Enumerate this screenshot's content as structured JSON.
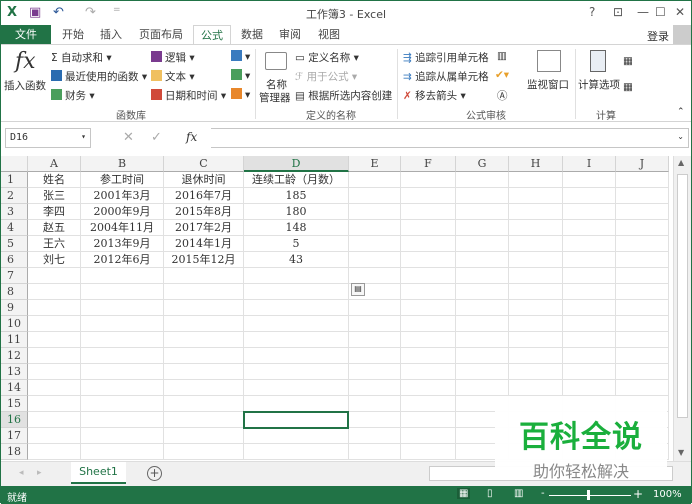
{
  "title": "工作簿3 - Excel",
  "quick_access": {
    "excel": "X",
    "save": "💾",
    "undo": "↶",
    "redo": "↷",
    "customize": "="
  },
  "window_controls": {
    "help": "?",
    "ribbon_options": "⊡",
    "minimize": "—",
    "maximize": "☐",
    "close": "✕"
  },
  "login": "登录",
  "tabs": [
    "文件",
    "开始",
    "插入",
    "页面布局",
    "公式",
    "数据",
    "审阅",
    "视图"
  ],
  "active_tab": "公式",
  "ribbon": {
    "insert_function": "插入函数",
    "autosum": "自动求和",
    "recent": "最近使用的函数",
    "financial": "财务",
    "logical": "逻辑",
    "text": "文本",
    "datetime": "日期和时间",
    "group_library": "函数库",
    "name_manager_1": "名称",
    "name_manager_2": "管理器",
    "define_name": "定义名称",
    "use_in_formula": "用于公式",
    "create_from_selection": "根据所选内容创建",
    "group_names": "定义的名称",
    "trace_precedents": "追踪引用单元格",
    "trace_dependents": "追踪从属单元格",
    "remove_arrows": "移去箭头",
    "watch_window": "监视窗口",
    "group_audit": "公式审核",
    "calc_options": "计算选项",
    "group_calc": "计算"
  },
  "formula_bar": {
    "name_box": "D16",
    "cancel": "✕",
    "enter": "✓",
    "fx": "fx",
    "value": ""
  },
  "columns": [
    "A",
    "B",
    "C",
    "D",
    "E",
    "F",
    "G",
    "H",
    "I",
    "J"
  ],
  "rows": [
    [
      "姓名",
      "参工时间",
      "退休时间",
      "连续工龄（月数）"
    ],
    [
      "张三",
      "2001年3月",
      "2016年7月",
      "185"
    ],
    [
      "李四",
      "2000年9月",
      "2015年8月",
      "180"
    ],
    [
      "赵五",
      "2004年11月",
      "2017年2月",
      "148"
    ],
    [
      "王六",
      "2013年9月",
      "2014年1月",
      "5"
    ],
    [
      "刘七",
      "2012年6月",
      "2015年12月",
      "43"
    ]
  ],
  "row_count": 18,
  "selected_cell": "D16",
  "sheet_tab": "Sheet1",
  "add_sheet": "+",
  "status": {
    "ready": "就绪",
    "zoom": "100%",
    "zoom_minus": "-",
    "zoom_plus": "+"
  },
  "watermark": {
    "title": "百科全说",
    "subtitle": "助你轻松解决"
  },
  "colors": {
    "accent": "#217346",
    "watermark": "#1aaf3c"
  }
}
